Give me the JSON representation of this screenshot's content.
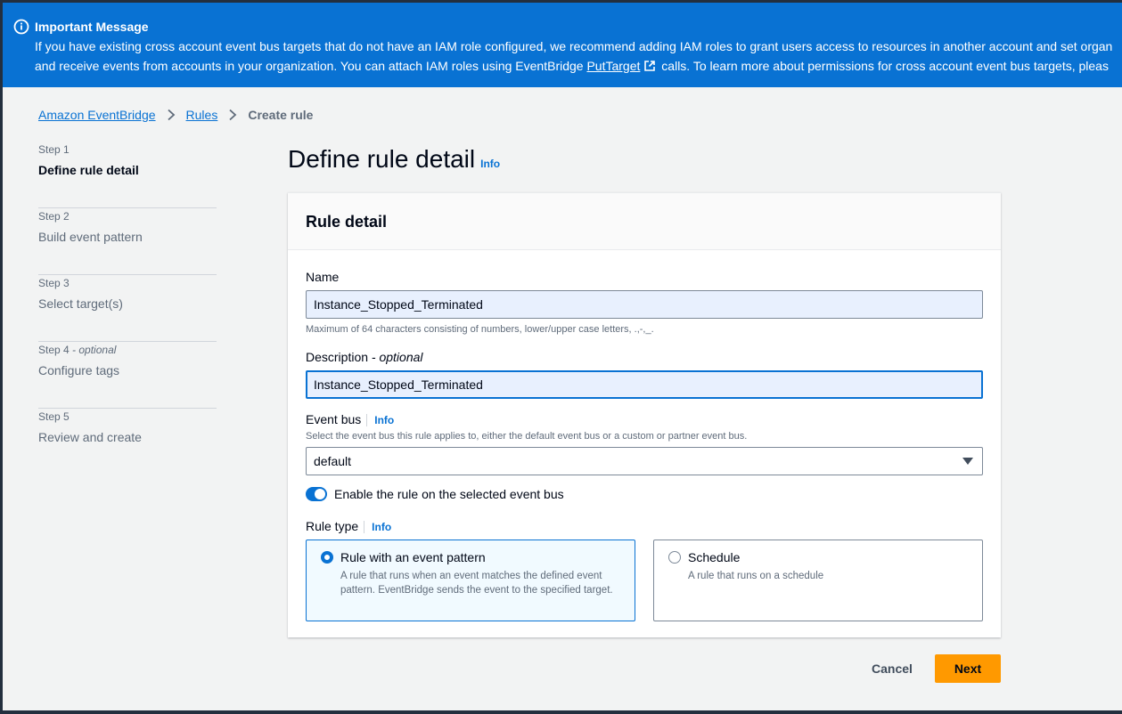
{
  "flash": {
    "title": "Important Message",
    "line1": "If you have existing cross account event bus targets that do not have an IAM role configured, we recommend adding IAM roles to grant users access to resources in another account and set organ",
    "line2_pre": "and receive events from accounts in your organization. You can attach IAM roles using EventBridge ",
    "line2_link": "PutTarget",
    "line2_post": " calls. To learn more about permissions for cross account event bus targets, pleas",
    "icon": "info-icon",
    "color": "#0972d3"
  },
  "breadcrumb": {
    "items": [
      "Amazon EventBridge",
      "Rules"
    ],
    "current": "Create rule"
  },
  "steps": [
    {
      "num": "Step 1",
      "optional": "",
      "name": "Define rule detail"
    },
    {
      "num": "Step 2",
      "optional": "",
      "name": "Build event pattern"
    },
    {
      "num": "Step 3",
      "optional": "",
      "name": "Select target(s)"
    },
    {
      "num": "Step 4",
      "optional": "- optional",
      "name": "Configure tags"
    },
    {
      "num": "Step 5",
      "optional": "",
      "name": "Review and create"
    }
  ],
  "page": {
    "title": "Define rule detail",
    "info": "Info"
  },
  "card": {
    "title": "Rule detail",
    "name_label": "Name",
    "name_value": "Instance_Stopped_Terminated",
    "name_hint": "Maximum of 64 characters consisting of numbers, lower/upper case letters, .,-,_.",
    "desc_label": "Description",
    "desc_optional": "- optional",
    "desc_value": "Instance_Stopped_Terminated",
    "bus_label": "Event bus",
    "bus_info": "Info",
    "bus_hint": "Select the event bus this rule applies to, either the default event bus or a custom or partner event bus.",
    "bus_value": "default",
    "toggle_label": "Enable the rule on the selected event bus",
    "toggle_on": true,
    "type_label": "Rule type",
    "type_info": "Info",
    "options": [
      {
        "title": "Rule with an event pattern",
        "desc": "A rule that runs when an event matches the defined event pattern. EventBridge sends the event to the specified target.",
        "selected": true
      },
      {
        "title": "Schedule",
        "desc": "A rule that runs on a schedule",
        "selected": false
      }
    ]
  },
  "actions": {
    "cancel": "Cancel",
    "next": "Next",
    "primary_color": "#ff9900"
  }
}
